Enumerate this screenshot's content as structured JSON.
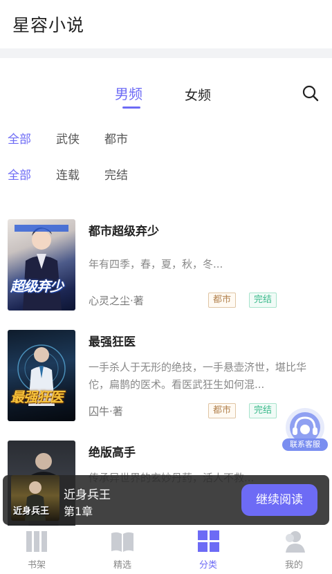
{
  "app": {
    "title": "星容小说"
  },
  "gender_tabs": [
    {
      "label": "男频",
      "active": true
    },
    {
      "label": "女频",
      "active": false
    }
  ],
  "icons": {
    "search": "search-icon",
    "service": "customer-service-icon"
  },
  "filters": {
    "category": [
      "全部",
      "武侠",
      "都市"
    ],
    "status": [
      "全部",
      "连载",
      "完结"
    ]
  },
  "books": [
    {
      "title": "都市超级弃少",
      "desc": "年有四季，春，夏，秋，冬...",
      "author": "心灵之尘·著",
      "tags": [
        "都市",
        "完结"
      ],
      "cover_text": "超级弃少"
    },
    {
      "title": "最强狂医",
      "desc": "一手杀人于无形的绝技，一手悬壶济世，堪比华佗，扁鹊的医术。看医武狂生如何混...",
      "author": "囚牛·著",
      "tags": [
        "都市",
        "完结"
      ],
      "cover_text": "最强狂医"
    },
    {
      "title": "绝版高手",
      "desc": "传承异世界的玄妙丹药，活人不救...",
      "author": "",
      "tags": [],
      "cover_text": ""
    }
  ],
  "service": {
    "label": "联系客服"
  },
  "continue_reading": {
    "book_title": "近身兵王",
    "chapter": "第1章",
    "button": "继续阅读",
    "cover_text": "近身兵王"
  },
  "tabbar": [
    {
      "label": "书架",
      "icon": "bookshelf-icon",
      "active": false
    },
    {
      "label": "精选",
      "icon": "open-book-icon",
      "active": false
    },
    {
      "label": "分类",
      "icon": "category-grid-icon",
      "active": true
    },
    {
      "label": "我的",
      "icon": "user-icon",
      "active": false
    }
  ],
  "colors": {
    "accent": "#6d6bf5",
    "tag_city": "#b38350",
    "tag_done": "#38b98a"
  }
}
